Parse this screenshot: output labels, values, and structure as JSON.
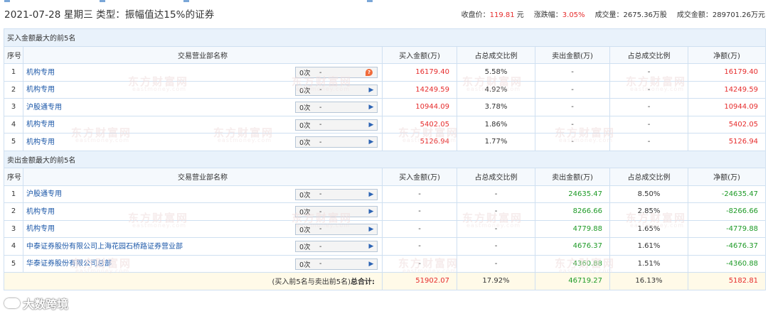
{
  "header": {
    "date": "2021-07-28",
    "weekday": "星期三",
    "type_label": "类型：振幅值达15%的证券"
  },
  "stats": {
    "close_label": "收盘价：",
    "close_value": "119.81",
    "close_unit": "元",
    "change_label": "涨跌幅：",
    "change_value": "3.05%",
    "volume": "成交量：2675.36万股",
    "amount": "成交金额：289701.26万元"
  },
  "buy_section": {
    "title": "买入金额最大的前5名",
    "headers": [
      "序号",
      "交易营业部名称",
      "买入金额(万)",
      "占总成交比例",
      "卖出金额(万)",
      "占总成交比例",
      "净额(万)"
    ],
    "rows": [
      {
        "idx": "1",
        "name": "机构专用",
        "count": "0次",
        "dash": "-",
        "buy": "16179.40",
        "buy_pct": "5.58%",
        "sell": "-",
        "sell_pct": "-",
        "net": "16179.40",
        "hint": true
      },
      {
        "idx": "2",
        "name": "机构专用",
        "count": "0次",
        "dash": "-",
        "buy": "14249.59",
        "buy_pct": "4.92%",
        "sell": "-",
        "sell_pct": "-",
        "net": "14249.59",
        "hint": false
      },
      {
        "idx": "3",
        "name": "沪股通专用",
        "count": "0次",
        "dash": "-",
        "buy": "10944.09",
        "buy_pct": "3.78%",
        "sell": "-",
        "sell_pct": "-",
        "net": "10944.09",
        "hint": false
      },
      {
        "idx": "4",
        "name": "机构专用",
        "count": "0次",
        "dash": "-",
        "buy": "5402.05",
        "buy_pct": "1.86%",
        "sell": "-",
        "sell_pct": "-",
        "net": "5402.05",
        "hint": false
      },
      {
        "idx": "5",
        "name": "机构专用",
        "count": "0次",
        "dash": "-",
        "buy": "5126.94",
        "buy_pct": "1.77%",
        "sell": "-",
        "sell_pct": "-",
        "net": "5126.94",
        "hint": false
      }
    ]
  },
  "sell_section": {
    "title": "卖出金额最大的前5名",
    "headers": [
      "序号",
      "交易营业部名称",
      "买入金额(万)",
      "占总成交比例",
      "卖出金额(万)",
      "占总成交比例",
      "净额(万)"
    ],
    "rows": [
      {
        "idx": "1",
        "name": "沪股通专用",
        "count": "0次",
        "dash": "-",
        "buy": "-",
        "buy_pct": "-",
        "sell": "24635.47",
        "sell_pct": "8.50%",
        "net": "-24635.47"
      },
      {
        "idx": "2",
        "name": "机构专用",
        "count": "0次",
        "dash": "-",
        "buy": "-",
        "buy_pct": "-",
        "sell": "8266.66",
        "sell_pct": "2.85%",
        "net": "-8266.66"
      },
      {
        "idx": "3",
        "name": "机构专用",
        "count": "0次",
        "dash": "-",
        "buy": "-",
        "buy_pct": "-",
        "sell": "4779.88",
        "sell_pct": "1.65%",
        "net": "-4779.88"
      },
      {
        "idx": "4",
        "name": "中泰证券股份有限公司上海花园石桥路证券营业部",
        "count": "0次",
        "dash": "-",
        "buy": "-",
        "buy_pct": "-",
        "sell": "4676.37",
        "sell_pct": "1.61%",
        "net": "-4676.37"
      },
      {
        "idx": "5",
        "name": "华泰证券股份有限公司总部",
        "count": "0次",
        "dash": "-",
        "buy": "-",
        "buy_pct": "-",
        "sell": "4360.88",
        "sell_pct": "1.51%",
        "net": "-4360.88"
      }
    ]
  },
  "totals": {
    "label_prefix": "(买入前5名与卖出前5名)",
    "label_bold": "总合计:",
    "buy": "51902.07",
    "buy_pct": "17.92%",
    "sell": "46719.27",
    "sell_pct": "16.13%",
    "net": "5182.81"
  },
  "watermark": {
    "text": "东方财富网",
    "sub": "eastmoney.com"
  },
  "logo": {
    "text": "大数跨境"
  },
  "colors": {
    "up": "#e62c2c",
    "down": "#1d9a26",
    "link": "#1b57a8",
    "section_bg": "#e9f2fb",
    "border": "#cfe0f1",
    "total_bg": "#fffae8"
  }
}
